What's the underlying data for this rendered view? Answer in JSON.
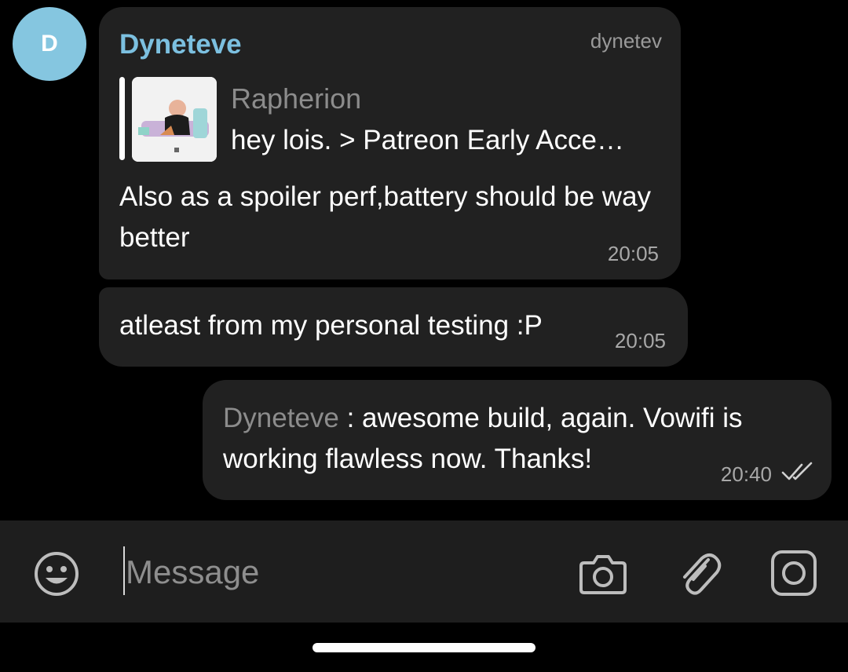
{
  "chat": {
    "avatar_letter": "D",
    "avatar_color": "#85c6e0",
    "messages": [
      {
        "sender": "Dyneteve",
        "sender_tag": "dynetev",
        "reply": {
          "name": "Rapherion",
          "text": "hey lois. > Patreon Early Acce…"
        },
        "text": "Also as a spoiler perf,battery should be way better",
        "time": "20:05"
      },
      {
        "text": "atleast from my personal testing :P",
        "time": "20:05"
      },
      {
        "quote_name": "Dyneteve",
        "text": " : awesome build, again. Vowifi is working flawless now. Thanks!",
        "time": "20:40",
        "status_icon": "double-check-icon"
      }
    ]
  },
  "composer": {
    "placeholder": "Message",
    "icons": [
      "emoji-icon",
      "camera-icon",
      "paperclip-icon",
      "instagram-icon"
    ]
  },
  "colors": {
    "background": "#000000",
    "bubble": "#212121",
    "sender_name": "#7cc0e0",
    "input_bar": "#1e1e1e"
  }
}
